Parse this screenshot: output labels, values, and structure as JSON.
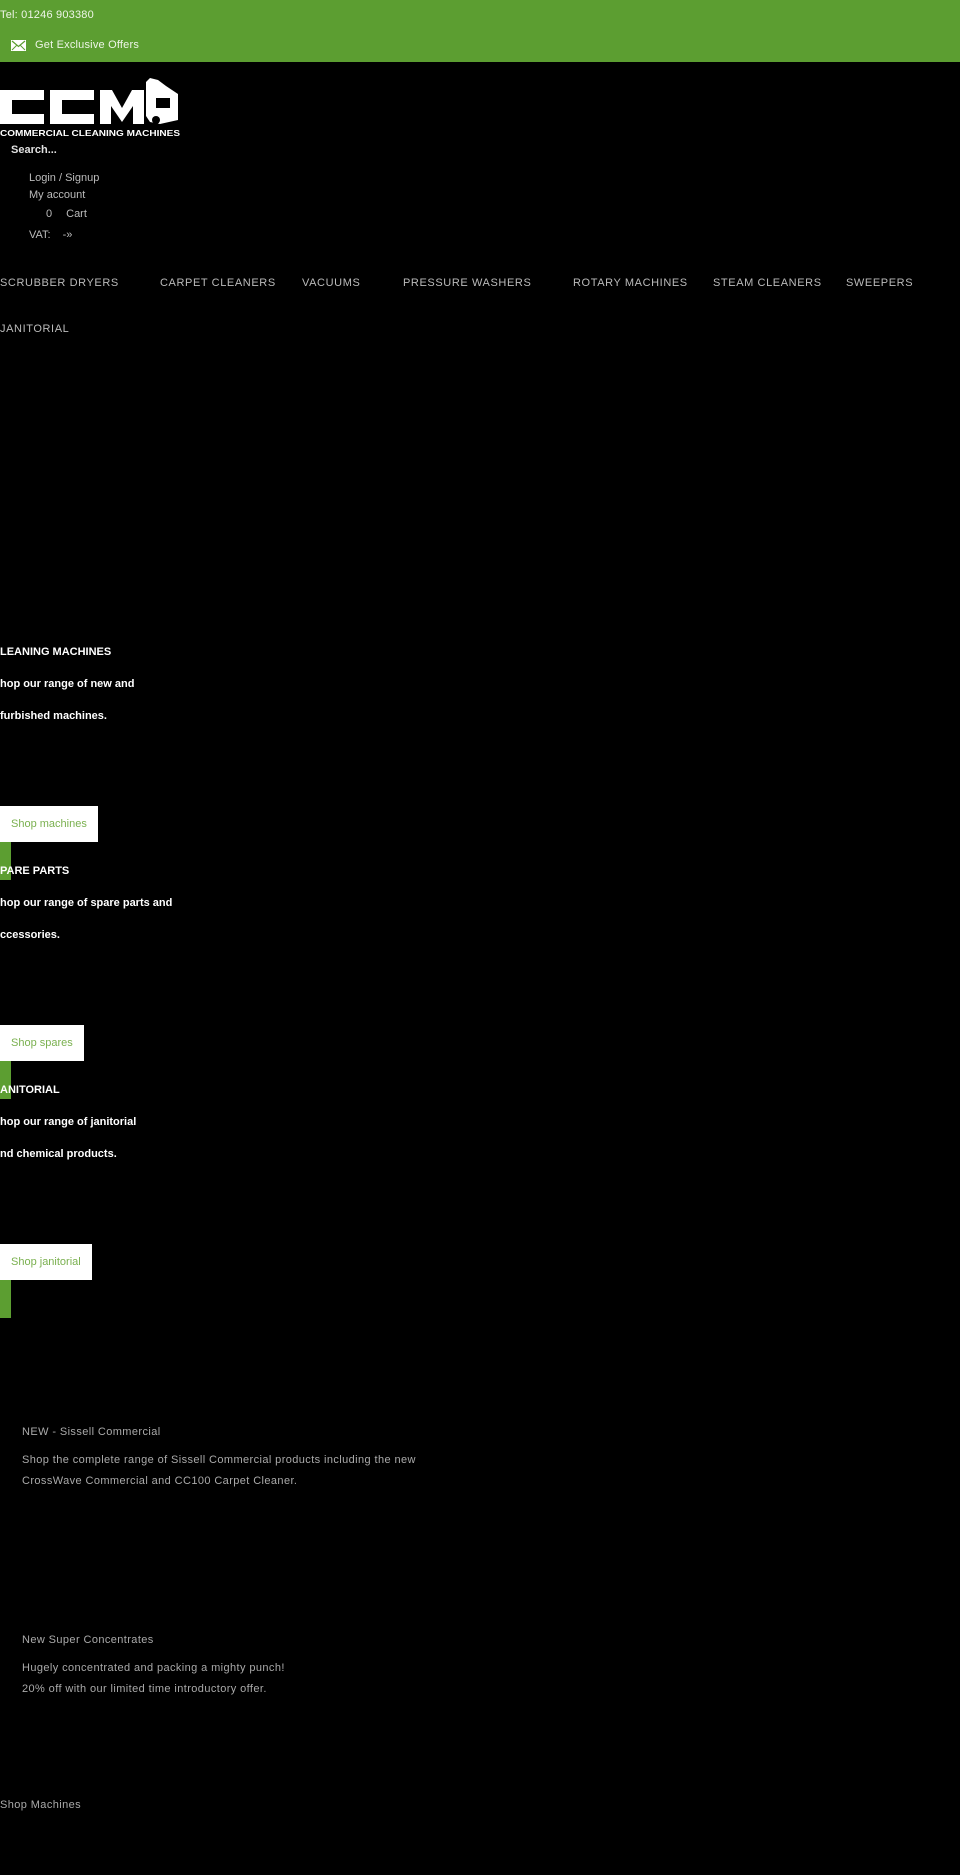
{
  "top_bar": {
    "telephone": "Tel: 01246 903380",
    "offers_label": "Get Exclusive Offers",
    "offers_icon": "envelope-icon",
    "background_color": "#5c9e31"
  },
  "header": {
    "logo_text": "CCM",
    "logo_subtitle": "COMMERCIAL CLEANING MACHINES",
    "search_placeholder": "Search...",
    "login_label": "Login / Signup",
    "account_label": "My account",
    "cart_count": "0",
    "cart_label": "Cart",
    "vat_label": "VAT:",
    "vat_toggle": "-»"
  },
  "nav": {
    "items": [
      {
        "label": "SCRUBBER DRYERS"
      },
      {
        "label": "CARPET CLEANERS"
      },
      {
        "label": "VACUUMS"
      },
      {
        "label": "PRESSURE WASHERS"
      },
      {
        "label": "ROTARY MACHINES"
      },
      {
        "label": "STEAM CLEANERS"
      },
      {
        "label": "SWEEPERS"
      },
      {
        "label": "JANITORIAL"
      }
    ]
  },
  "categories": [
    {
      "title": "LEANING MACHINES",
      "line1": "hop our range of new and",
      "line2": "furbished machines.",
      "button": "Shop machines"
    },
    {
      "title": "PARE PARTS",
      "line1": "hop our range of spare parts and",
      "line2": "ccessories.",
      "button": "Shop spares"
    },
    {
      "title": "ANITORIAL",
      "line1": "hop our range of janitorial",
      "line2": "nd chemical products.",
      "button": "Shop janitorial"
    }
  ],
  "promos": [
    {
      "title": "NEW - Sissell Commercial",
      "line1": "Shop the complete range of Sissell Commercial products including the new",
      "line2": "CrossWave Commercial and CC100 Carpet Cleaner."
    },
    {
      "title": "New Super Concentrates",
      "line1": "Hugely concentrated and packing a mighty punch!",
      "line2": "20% off with our limited time introductory offer."
    }
  ],
  "footer_link": "Shop Machines",
  "colors": {
    "brand_green": "#5c9e31",
    "button_text_green": "#7ab04f"
  }
}
